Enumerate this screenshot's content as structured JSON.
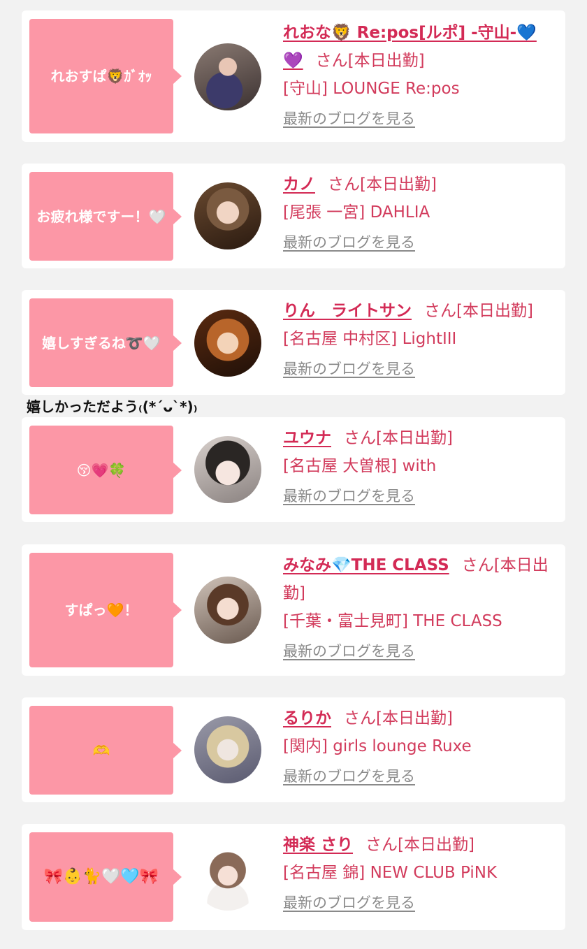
{
  "comment_text": "嬉しかっただよう₍(*´ᴗ`*)₎",
  "cards": [
    {
      "bubble": "れおすぱ🦁ｶﾞｵｯ",
      "name": "れおな🦁 Re:pos[ルポ] -守山-💙💜",
      "san": "さん",
      "status": "[本日出勤]",
      "shop": "[守山] LOUNGE Re:pos",
      "blog": "最新のブログを見る"
    },
    {
      "bubble": "お疲れ様ですー！🤍",
      "name": "カノ",
      "san": "さん",
      "status": "[本日出勤]",
      "shop": "[尾張 一宮] DAHLIA",
      "blog": "最新のブログを見る"
    },
    {
      "bubble": "嬉しすぎるね➰🤍",
      "name": "りん　ライトサン",
      "san": "さん",
      "status": "[本日出勤]",
      "shop": "[名古屋 中村区] LightIII",
      "blog": "最新のブログを見る"
    },
    {
      "bubble": "😚💗🍀",
      "name": "ユウナ",
      "san": "さん",
      "status": "[本日出勤]",
      "shop": "[名古屋 大曽根] with",
      "blog": "最新のブログを見る"
    },
    {
      "bubble": "すぱっ🧡！",
      "name": "みなみ💎THE CLASS",
      "san": "さん",
      "status": "[本日出勤]",
      "shop": "[千葉・富士見町] THE CLASS",
      "blog": "最新のブログを見る"
    },
    {
      "bubble": "🫶",
      "name": "るりか",
      "san": "さん",
      "status": "[本日出勤]",
      "shop": "[関内] girls lounge Ruxe",
      "blog": "最新のブログを見る"
    },
    {
      "bubble": "🎀👶🐈🤍🩵🎀",
      "name": "神楽 さり",
      "san": "さん",
      "status": "[本日出勤]",
      "shop": "[名古屋 錦] NEW CLUB PiNK",
      "blog": "最新のブログを見る"
    }
  ]
}
